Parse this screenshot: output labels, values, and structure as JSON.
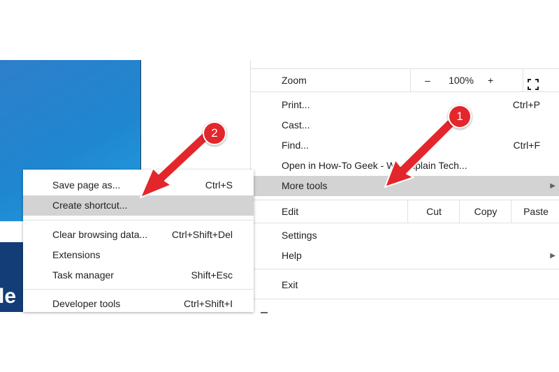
{
  "background": {
    "partial_text": "le"
  },
  "main_menu": {
    "zoom": {
      "label": "Zoom",
      "minus": "–",
      "value": "100%",
      "plus": "+"
    },
    "items": [
      {
        "label": "Print...",
        "shortcut": "Ctrl+P"
      },
      {
        "label": "Cast...",
        "shortcut": ""
      },
      {
        "label": "Find...",
        "shortcut": "Ctrl+F"
      },
      {
        "label": "Open in How-To Geek - We Explain Tech...",
        "shortcut": ""
      },
      {
        "label": "More tools",
        "shortcut": "",
        "highlighted": true,
        "submenu": true
      }
    ],
    "edit": {
      "label": "Edit",
      "cut": "Cut",
      "copy": "Copy",
      "paste": "Paste"
    },
    "settings": "Settings",
    "help": "Help",
    "exit": "Exit"
  },
  "submenu": {
    "items": [
      {
        "label": "Save page as...",
        "shortcut": "Ctrl+S"
      },
      {
        "label": "Create shortcut...",
        "shortcut": "",
        "highlighted": true
      },
      {
        "label": "Clear browsing data...",
        "shortcut": "Ctrl+Shift+Del"
      },
      {
        "label": "Extensions",
        "shortcut": ""
      },
      {
        "label": "Task manager",
        "shortcut": "Shift+Esc"
      },
      {
        "label": "Developer tools",
        "shortcut": "Ctrl+Shift+I"
      }
    ]
  },
  "annotations": {
    "marker_1": "1",
    "marker_2": "2",
    "color": "#e3262b"
  }
}
